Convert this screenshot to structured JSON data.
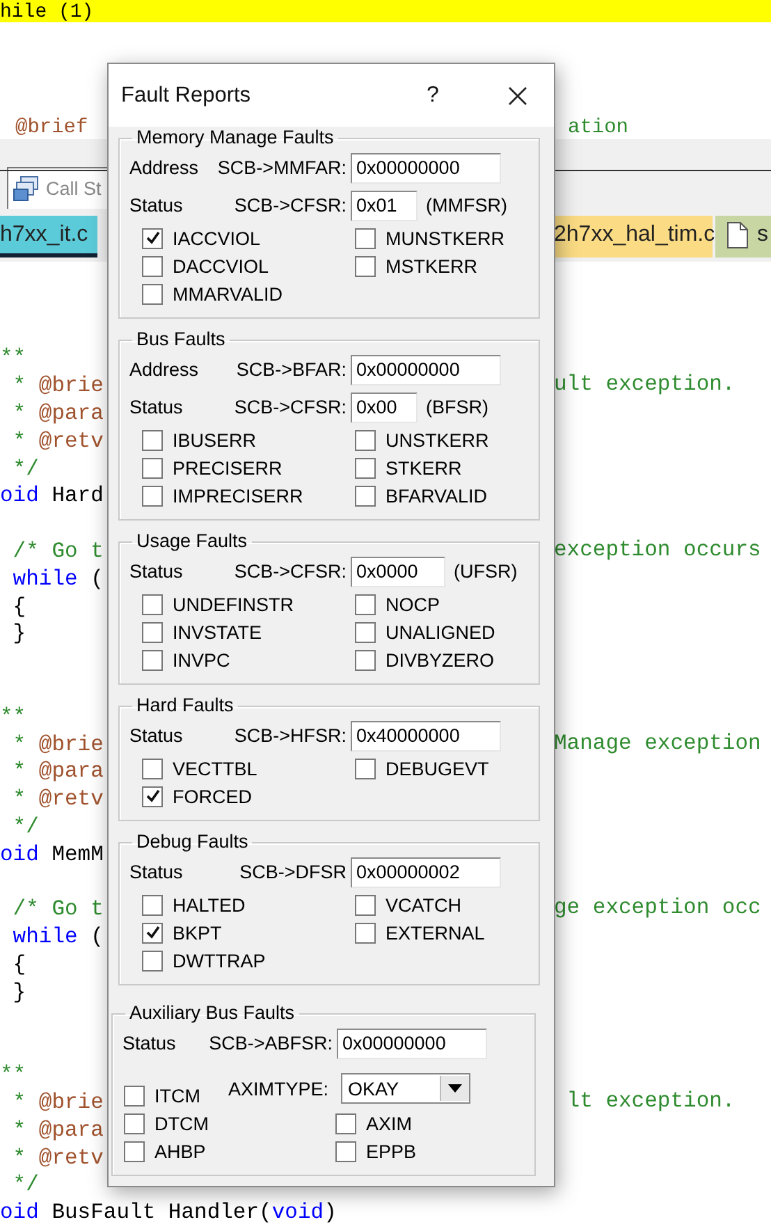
{
  "editor": {
    "current_line": "hile (1)",
    "partial_line": {
      "left": "@brief",
      "right": "ation"
    },
    "panel_tabs": [
      {
        "label": "Call St",
        "selected": true
      }
    ],
    "file_tabs": [
      {
        "label": "h7xx_it.c",
        "selected": true,
        "color": "#5ccbd9",
        "icon_shown": false
      },
      {
        "label": "2h7xx_hal_tim.c",
        "selected": false,
        "color": "#fbdc84",
        "icon_shown": false
      },
      {
        "label": "s",
        "selected": false,
        "color": "#c8d6a4",
        "icon_shown": true
      }
    ],
    "functions": [
      {
        "doc": [
          {
            "left": [
              {
                "text": "**",
                "kind": "comment"
              }
            ]
          },
          {
            "left": [
              {
                "text": " * ",
                "kind": "comment"
              },
              {
                "text": "@brie",
                "kind": "tag"
              }
            ],
            "right": [
              {
                "text": "ult exception.",
                "kind": "comment"
              }
            ]
          },
          {
            "left": [
              {
                "text": " * ",
                "kind": "comment"
              },
              {
                "text": "@para",
                "kind": "tag"
              }
            ]
          },
          {
            "left": [
              {
                "text": " * ",
                "kind": "comment"
              },
              {
                "text": "@retv",
                "kind": "tag"
              }
            ]
          },
          {
            "left": [
              {
                "text": " */",
                "kind": "comment"
              }
            ]
          },
          {
            "left": [
              {
                "text": "oid",
                "kind": "keyword"
              },
              {
                "text": " Hard",
                "kind": "plain"
              }
            ]
          }
        ],
        "body": [
          {
            "left": [
              {
                "text": " /* Go t",
                "kind": "comment"
              }
            ],
            "right": [
              {
                "text": "exception occurs",
                "kind": "comment"
              }
            ]
          },
          {
            "left": [
              {
                "text": " while",
                "kind": "keyword"
              },
              {
                "text": " (",
                "kind": "plain"
              }
            ]
          },
          {
            "left": [
              {
                "text": " {",
                "kind": "plain"
              }
            ]
          },
          {
            "left": [
              {
                "text": " }",
                "kind": "plain"
              }
            ]
          }
        ]
      },
      {
        "doc": [
          {
            "left": [
              {
                "text": "**",
                "kind": "comment"
              }
            ]
          },
          {
            "left": [
              {
                "text": " * ",
                "kind": "comment"
              },
              {
                "text": "@brie",
                "kind": "tag"
              }
            ],
            "right": [
              {
                "text": "Manage exception",
                "kind": "comment"
              }
            ]
          },
          {
            "left": [
              {
                "text": " * ",
                "kind": "comment"
              },
              {
                "text": "@para",
                "kind": "tag"
              }
            ]
          },
          {
            "left": [
              {
                "text": " * ",
                "kind": "comment"
              },
              {
                "text": "@retv",
                "kind": "tag"
              }
            ]
          },
          {
            "left": [
              {
                "text": " */",
                "kind": "comment"
              }
            ]
          },
          {
            "left": [
              {
                "text": "oid",
                "kind": "keyword"
              },
              {
                "text": " MemM",
                "kind": "plain"
              }
            ]
          }
        ],
        "body": [
          {
            "left": [
              {
                "text": " /* Go t",
                "kind": "comment"
              }
            ],
            "right": [
              {
                "text": "ge exception occ",
                "kind": "comment"
              }
            ]
          },
          {
            "left": [
              {
                "text": " while",
                "kind": "keyword"
              },
              {
                "text": " (",
                "kind": "plain"
              }
            ]
          },
          {
            "left": [
              {
                "text": " {",
                "kind": "plain"
              }
            ]
          },
          {
            "left": [
              {
                "text": " }",
                "kind": "plain"
              }
            ]
          }
        ]
      },
      {
        "doc": [
          {
            "left": [
              {
                "text": "**",
                "kind": "comment"
              }
            ]
          },
          {
            "left": [
              {
                "text": " * ",
                "kind": "comment"
              },
              {
                "text": "@brie",
                "kind": "tag"
              }
            ],
            "right": [
              {
                "text": " lt exception.",
                "kind": "comment"
              }
            ]
          },
          {
            "left": [
              {
                "text": " * ",
                "kind": "comment"
              },
              {
                "text": "@para",
                "kind": "tag"
              }
            ]
          },
          {
            "left": [
              {
                "text": " * ",
                "kind": "comment"
              },
              {
                "text": "@retv",
                "kind": "tag"
              }
            ]
          },
          {
            "left": [
              {
                "text": " */",
                "kind": "comment"
              }
            ]
          },
          {
            "left": [
              {
                "text": "oid",
                "kind": "keyword"
              },
              {
                "text": " BusFault Handler(",
                "kind": "plain"
              },
              {
                "text": "void",
                "kind": "keyword"
              },
              {
                "text": ")",
                "kind": "plain"
              }
            ]
          }
        ]
      }
    ]
  },
  "dialog": {
    "title": "Fault Reports",
    "help": "?",
    "groups": [
      {
        "title": "Memory Manage Faults",
        "kind": "standard",
        "registers": [
          {
            "label": "Address",
            "register": "SCB->MMFAR:",
            "value": "0x00000000"
          },
          {
            "label": "Status",
            "register": "SCB->CFSR:",
            "value": "0x01",
            "suffix": "(MMFSR)"
          }
        ],
        "flags": [
          {
            "label": "IACCVIOL",
            "checked": true
          },
          {
            "label": "MUNSTKERR",
            "checked": false
          },
          {
            "label": "DACCVIOL",
            "checked": false
          },
          {
            "label": "MSTKERR",
            "checked": false
          },
          {
            "label": "MMARVALID",
            "checked": false
          }
        ]
      },
      {
        "title": "Bus Faults",
        "kind": "standard",
        "registers": [
          {
            "label": "Address",
            "register": "SCB->BFAR:",
            "value": "0x00000000"
          },
          {
            "label": "Status",
            "register": "SCB->CFSR:",
            "value": "0x00",
            "suffix": "(BFSR)"
          }
        ],
        "flags": [
          {
            "label": "IBUSERR",
            "checked": false
          },
          {
            "label": "UNSTKERR",
            "checked": false
          },
          {
            "label": "PRECISERR",
            "checked": false
          },
          {
            "label": "STKERR",
            "checked": false
          },
          {
            "label": "IMPRECISERR",
            "checked": false
          },
          {
            "label": "BFARVALID",
            "checked": false
          }
        ]
      },
      {
        "title": "Usage Faults",
        "kind": "standard",
        "registers": [
          {
            "label": "Status",
            "register": "SCB->CFSR:",
            "value": "0x0000",
            "suffix": "(UFSR)"
          }
        ],
        "flags": [
          {
            "label": "UNDEFINSTR",
            "checked": false
          },
          {
            "label": "NOCP",
            "checked": false
          },
          {
            "label": "INVSTATE",
            "checked": false
          },
          {
            "label": "UNALIGNED",
            "checked": false
          },
          {
            "label": "INVPC",
            "checked": false
          },
          {
            "label": "DIVBYZERO",
            "checked": false
          }
        ]
      },
      {
        "title": "Hard Faults",
        "kind": "standard",
        "registers": [
          {
            "label": "Status",
            "register": "SCB->HFSR:",
            "value": "0x40000000"
          }
        ],
        "flags": [
          {
            "label": "VECTTBL",
            "checked": false
          },
          {
            "label": "DEBUGEVT",
            "checked": false
          },
          {
            "label": "FORCED",
            "checked": true
          }
        ]
      },
      {
        "title": "Debug Faults",
        "kind": "standard",
        "registers": [
          {
            "label": "Status",
            "register": "SCB->DFSR",
            "value": "0x00000002"
          }
        ],
        "flags": [
          {
            "label": "HALTED",
            "checked": false
          },
          {
            "label": "VCATCH",
            "checked": false
          },
          {
            "label": "BKPT",
            "checked": true
          },
          {
            "label": "EXTERNAL",
            "checked": false
          },
          {
            "label": "DWTTRAP",
            "checked": false
          }
        ]
      },
      {
        "title": "Auxiliary Bus Faults",
        "kind": "aux",
        "registers": [
          {
            "label": "Status",
            "register": "SCB->ABFSR:",
            "value": "0x00000000"
          }
        ],
        "select": {
          "label": "AXIMTYPE:",
          "value": "OKAY"
        },
        "flags": [
          {
            "label": "ITCM",
            "checked": false
          },
          {
            "label": "DTCM",
            "checked": false
          },
          {
            "label": "AHBP",
            "checked": false
          },
          {
            "label": "AXIM",
            "checked": false
          },
          {
            "label": "EPPB",
            "checked": false
          }
        ]
      }
    ]
  }
}
